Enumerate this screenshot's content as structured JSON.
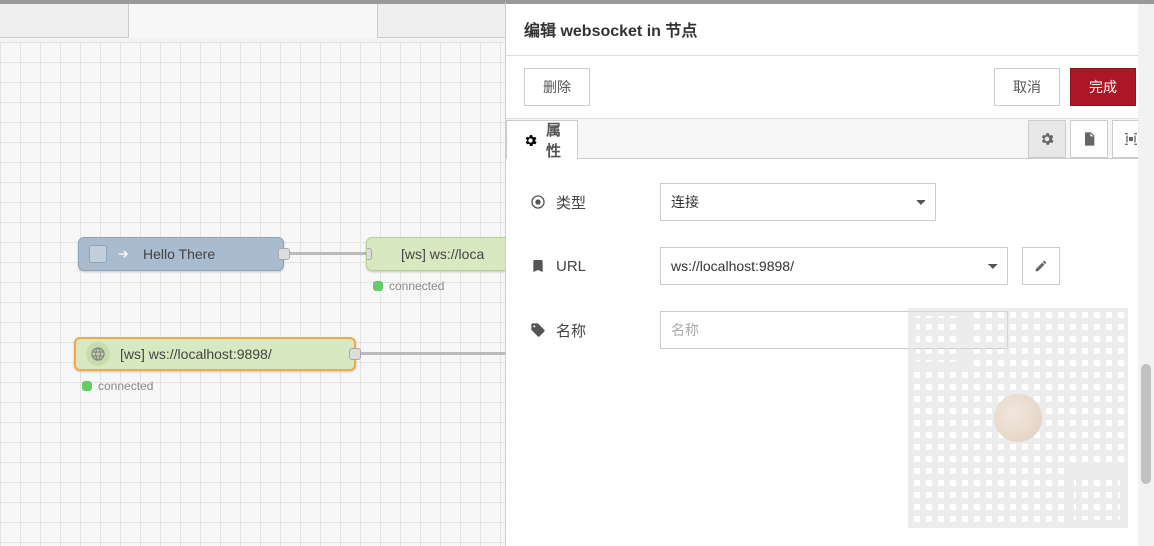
{
  "panel": {
    "title": "编辑 websocket in 节点",
    "delete_label": "删除",
    "cancel_label": "取消",
    "done_label": "完成",
    "tab_properties_label": "属性"
  },
  "form": {
    "type": {
      "label": "类型",
      "value": "连接"
    },
    "url": {
      "label": "URL",
      "value": "ws://localhost:9898/"
    },
    "name": {
      "label": "名称",
      "placeholder": "名称",
      "value": ""
    }
  },
  "nodes": {
    "inject_label": "Hello There",
    "wsout_label": "[ws] ws://loca",
    "wsout_status": "connected",
    "wsin_label": "[ws] ws://localhost:9898/",
    "wsin_status": "connected"
  }
}
